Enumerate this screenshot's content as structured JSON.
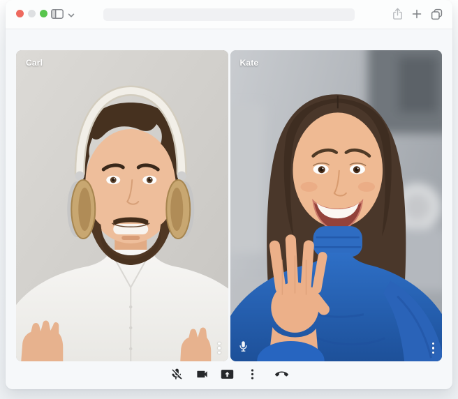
{
  "window": {
    "traffic_lights": [
      {
        "name": "close",
        "color": "#ee6a5f"
      },
      {
        "name": "minimize",
        "color": "#dee0e2"
      },
      {
        "name": "zoom",
        "color": "#58c54d"
      }
    ],
    "toolbar": {
      "left_icons": [
        "sidebar-icon",
        "chevron-down-icon"
      ],
      "address_value": "",
      "address_placeholder": "",
      "right_icons": [
        "share-icon",
        "new-tab-icon",
        "tabs-overview-icon"
      ]
    }
  },
  "call": {
    "participants": [
      {
        "name": "Carl",
        "scene": "man with dark hair and beard wearing cream headphones and white shirt on light gray background",
        "overlay_icons": [
          "more-vert-icon"
        ]
      },
      {
        "name": "Kate",
        "scene": "woman in royal blue turtleneck smiling and gesturing, blurred home background",
        "overlay_icons": [
          "mic-icon",
          "more-vert-icon"
        ]
      }
    ],
    "controls": [
      {
        "icon": "mic-off-icon"
      },
      {
        "icon": "videocam-icon"
      },
      {
        "icon": "present-screen-icon"
      },
      {
        "icon": "more-vert-icon"
      },
      {
        "icon": "call-end-icon"
      }
    ]
  },
  "colors": {
    "control_icon": "#26282b",
    "toolbar_icon": "#7d8084",
    "share_icon": "#b6b9bd",
    "sweater_blue": "#2765c0",
    "carl_background": "#d5d3cf",
    "window_background": "#f6f8fa"
  }
}
